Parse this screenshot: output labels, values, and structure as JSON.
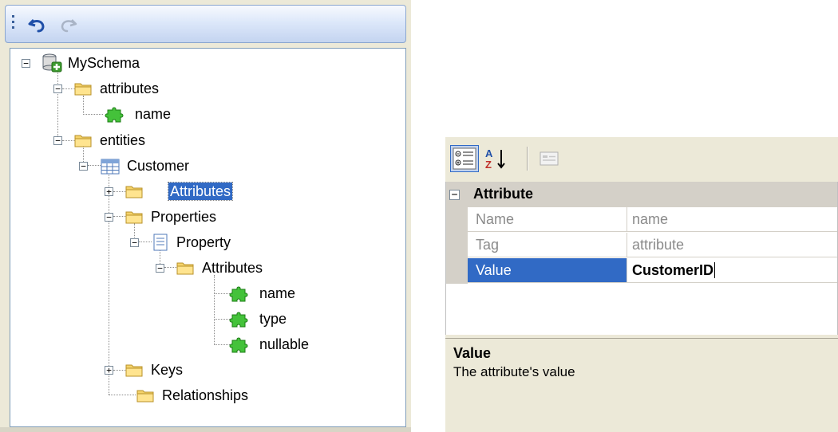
{
  "toolbar": {
    "undo_icon": "undo-icon",
    "redo_icon": "redo-icon"
  },
  "tree": {
    "root": "MySchema",
    "attributes_folder": "attributes",
    "attributes_name": "name",
    "entities_folder": "entities",
    "customer": "Customer",
    "customer_attributes": "Attributes",
    "properties": "Properties",
    "property": "Property",
    "property_attributes": "Attributes",
    "attr_name": "name",
    "attr_type": "type",
    "attr_nullable": "nullable",
    "keys": "Keys",
    "relationships": "Relationships",
    "selected": "Attributes"
  },
  "property_grid": {
    "toolbar": {
      "categorized_icon": "categorized-icon",
      "alphabetical_icon": "sort-az-icon",
      "pages_icon": "property-pages-icon"
    },
    "category": "Attribute",
    "rows": [
      {
        "name": "Name",
        "value": "name"
      },
      {
        "name": "Tag",
        "value": "attribute"
      },
      {
        "name": "Value",
        "value": "CustomerID"
      }
    ],
    "description": {
      "title": "Value",
      "text": "The attribute's value"
    }
  },
  "colors": {
    "selection": "#316ac5",
    "panel_bg": "#ece9d8",
    "toolbar_blue": "#c4d4f0"
  }
}
